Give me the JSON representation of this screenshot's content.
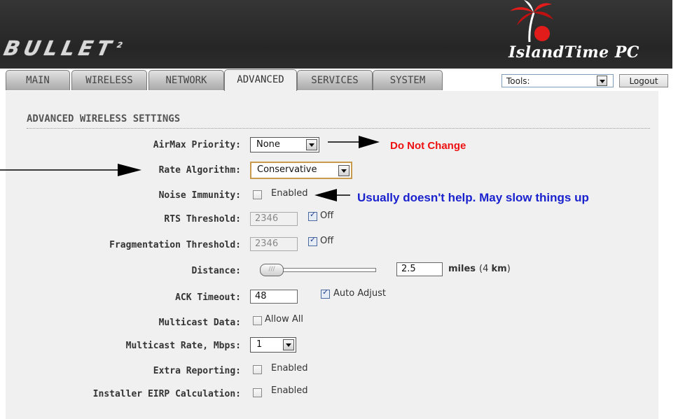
{
  "header": {
    "product_logo": "BULLET",
    "product_sup": "2",
    "brand": "IslandTime PC"
  },
  "tabs": [
    {
      "label": "MAIN",
      "active": false
    },
    {
      "label": "WIRELESS",
      "active": false
    },
    {
      "label": "NETWORK",
      "active": false
    },
    {
      "label": "ADVANCED",
      "active": true
    },
    {
      "label": "SERVICES",
      "active": false
    },
    {
      "label": "SYSTEM",
      "active": false
    }
  ],
  "toolbar": {
    "tools_value": "Tools:",
    "logout_label": "Logout"
  },
  "section": {
    "title": "ADVANCED WIRELESS SETTINGS"
  },
  "fields": {
    "airmax_priority": {
      "label": "AirMax Priority:",
      "value": "None"
    },
    "rate_algorithm": {
      "label": "Rate Algorithm:",
      "value": "Conservative"
    },
    "noise_immunity": {
      "label": "Noise Immunity:",
      "checkbox_label": "Enabled",
      "checked": false
    },
    "rts_threshold": {
      "label": "RTS Threshold:",
      "value": "2346",
      "checkbox_label": "Off",
      "checked": true
    },
    "fragmentation_threshold": {
      "label": "Fragmentation Threshold:",
      "value": "2346",
      "checkbox_label": "Off",
      "checked": true
    },
    "distance": {
      "label": "Distance:",
      "value": "2.5",
      "unit": "miles",
      "km_text": "(4 ",
      "km_value": "km",
      "km_close": ")",
      "slider_fraction": 0.03
    },
    "ack_timeout": {
      "label": "ACK Timeout:",
      "value": "48",
      "checkbox_label": "Auto Adjust",
      "checked": true
    },
    "multicast_data": {
      "label": "Multicast Data:",
      "checkbox_label": "Allow All",
      "checked": false
    },
    "multicast_rate": {
      "label": "Multicast Rate, Mbps:",
      "value": "1"
    },
    "extra_reporting": {
      "label": "Extra Reporting:",
      "checkbox_label": "Enabled",
      "checked": false
    },
    "installer_eirp": {
      "label": "Installer EIRP Calculation:",
      "checkbox_label": "Enabled",
      "checked": false
    }
  },
  "annotations": {
    "airmax_note": "Do Not Change",
    "noise_note": "Usually doesn't help.  May slow things up"
  },
  "colors": {
    "note_red": "#ee1111",
    "note_blue": "#1a22ce",
    "highlight_border": "#c89a4e"
  }
}
